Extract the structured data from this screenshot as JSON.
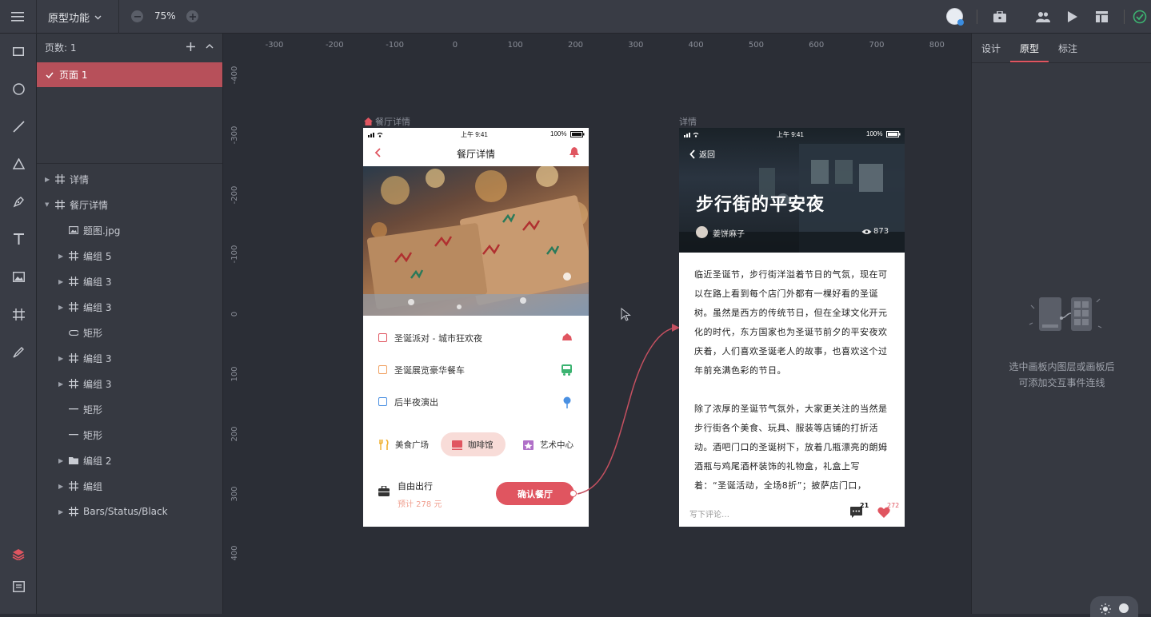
{
  "topbar": {
    "title": "原型功能",
    "zoom": "75%"
  },
  "layers": {
    "pages_label": "页数: 1",
    "page_item": "页面 1",
    "items": [
      {
        "label": "详情",
        "arrow": "right",
        "icon": "artboard"
      },
      {
        "label": "餐厅详情",
        "arrow": "down",
        "icon": "artboard"
      },
      {
        "label": "题图.jpg",
        "arrow": "",
        "icon": "image"
      },
      {
        "label": "编组 5",
        "arrow": "right",
        "icon": "artboard"
      },
      {
        "label": "编组 3",
        "arrow": "right",
        "icon": "artboard"
      },
      {
        "label": "编组 3",
        "arrow": "right",
        "icon": "artboard"
      },
      {
        "label": "矩形",
        "arrow": "",
        "icon": "rect"
      },
      {
        "label": "编组 3",
        "arrow": "right",
        "icon": "artboard"
      },
      {
        "label": "编组 3",
        "arrow": "right",
        "icon": "artboard"
      },
      {
        "label": "矩形",
        "arrow": "",
        "icon": "line"
      },
      {
        "label": "矩形",
        "arrow": "",
        "icon": "line"
      },
      {
        "label": "编组 2",
        "arrow": "right",
        "icon": "folder"
      },
      {
        "label": "编组",
        "arrow": "right",
        "icon": "artboard"
      },
      {
        "label": "Bars/Status/Black",
        "arrow": "right",
        "icon": "artboard"
      }
    ]
  },
  "ruler": {
    "top": [
      "-300",
      "-200",
      "-100",
      "0",
      "100",
      "200",
      "300",
      "400",
      "500",
      "600",
      "700",
      "800"
    ],
    "left": [
      "-400",
      "-300",
      "-200",
      "-100",
      "0",
      "100",
      "200",
      "300",
      "400"
    ]
  },
  "artboard1": {
    "name": "餐厅详情",
    "time": "上午 9:41",
    "battery": "100%",
    "title": "餐厅详情",
    "list": [
      {
        "text": "圣诞派对 - 城市狂欢夜",
        "color": "#e05560"
      },
      {
        "text": "圣诞展览豪华餐车",
        "color": "#f0a060"
      },
      {
        "text": "后半夜演出",
        "color": "#4a90e2"
      }
    ],
    "categories": [
      "美食广场",
      "咖啡馆",
      "艺术中心"
    ],
    "trip_title": "自由出行",
    "trip_price": "预计 278 元",
    "confirm": "确认餐厅"
  },
  "artboard2": {
    "name": "详情",
    "time": "上午 9:41",
    "battery": "100%",
    "back": "返回",
    "headline": "步行街的平安夜",
    "author": "姜饼麻子",
    "views": "873",
    "para1": "临近圣诞节，步行街洋溢着节日的气氛，现在可以在路上看到每个店门外都有一棵好看的圣诞树。虽然是西方的传统节日，但在全球文化开元化的时代，东方国家也为圣诞节前夕的平安夜欢庆着，人们喜欢圣诞老人的故事，也喜欢这个过年前充满色彩的节日。",
    "para2": "除了浓厚的圣诞节气氛外，大家更关注的当然是步行街各个美食、玩具、服装等店铺的打折活动。酒吧门口的圣诞树下，放着几瓶漂亮的朗姆酒瓶与鸡尾酒杯装饰的礼物盒，礼盒上写着：“圣诞活动，全场8折”；披萨店门口，",
    "comment_placeholder": "写下评论…",
    "comments": "21",
    "likes": "272"
  },
  "rightpanel": {
    "tabs": [
      "设计",
      "原型",
      "标注"
    ],
    "active_tab": "原型",
    "hint1": "选中画板内图层或画板后",
    "hint2": "可添加交互事件连线"
  },
  "colors": {
    "accent": "#e05560",
    "selected": "#b7505a"
  }
}
